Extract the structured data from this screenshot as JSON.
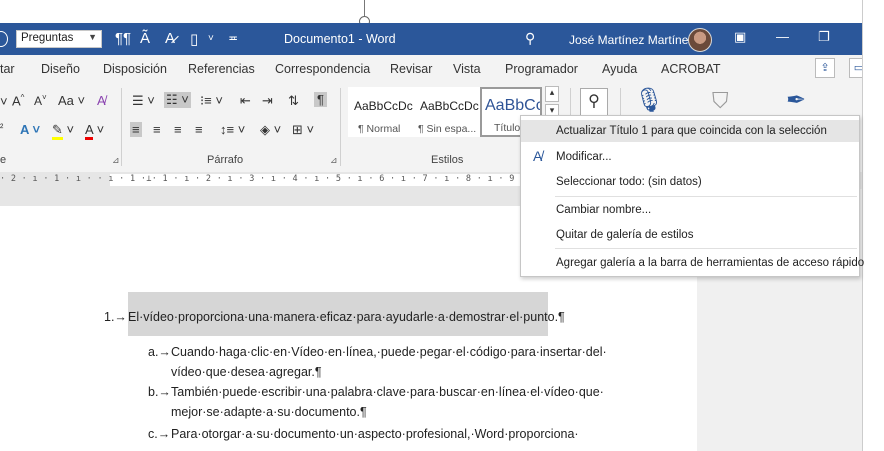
{
  "titlebar": {
    "style_box_value": "Preguntas",
    "doc_title": "Documento1  -  Word",
    "user_name": "José Martínez Martínez",
    "icons": [
      "pilcrow-icon",
      "text-effect-icon",
      "clear-format-icon",
      "style-icon",
      "customize-qat-icon",
      "search-icon",
      "ribbon-display-icon",
      "minimize-icon",
      "restore-icon"
    ]
  },
  "tabs": [
    "tar",
    "Diseño",
    "Disposición",
    "Referencias",
    "Correspondencia",
    "Revisar",
    "Vista",
    "Programador",
    "Ayuda",
    "ACROBAT"
  ],
  "ribbon": {
    "font_row1": [
      "A^",
      "A˅",
      "Aa",
      "A"
    ],
    "styles_gallery": [
      {
        "sample": "AaBbCcDc",
        "name": "¶ Normal"
      },
      {
        "sample": "AaBbCcDc",
        "name": "¶ Sin espa..."
      },
      {
        "sample": "AaBbCc",
        "name": "Título"
      }
    ],
    "group_labels": {
      "font": "e",
      "paragraph": "Párrafo",
      "styles": "Estilos"
    }
  },
  "ruler": {
    "text": "· 2 · ı · 1 · ı ·   · ı · 1 ·⊥· 1 · ı · 2 · ı · 3 · ı · 4 · ı · 5 · ı · 6 · ı · 7 · ı · 8 · ı · 9 · ı · 10 · ı · 11 · ı · 12 · ı ·"
  },
  "context_menu": {
    "items": [
      {
        "label": "Actualizar Título 1 para que coincida con la selección",
        "highlighted": true
      },
      {
        "label": "Modificar...",
        "icon": "modify-style-icon"
      },
      {
        "label": "Seleccionar todo: (sin datos)"
      },
      {
        "label": "Cambiar nombre..."
      },
      {
        "label": "Quitar de galería de estilos"
      },
      {
        "label": "Agregar galería a la barra de herramientas de acceso rápido"
      }
    ]
  },
  "document": {
    "item1_num": "1.→",
    "item1_text": "El·vídeo·proporciona·una·manera·eficaz·para·ayudarle·a·demostrar·el·punto.¶",
    "a_num": "a.→",
    "a_line1": "Cuando·haga·clic·en·Vídeo·en·línea,·puede·pegar·el·código·para·insertar·del·",
    "a_line2": "vídeo·que·desea·agregar.¶",
    "b_num": "b.→",
    "b_line1": "También·puede·escribir·una·palabra·clave·para·buscar·en·línea·el·vídeo·que·",
    "b_line2": "mejor·se·adapte·a·su·documento.¶",
    "c_num": "c.→",
    "c_line1": "Para·otorgar·a·su·documento·un·aspecto·profesional,·Word·proporciona·"
  }
}
